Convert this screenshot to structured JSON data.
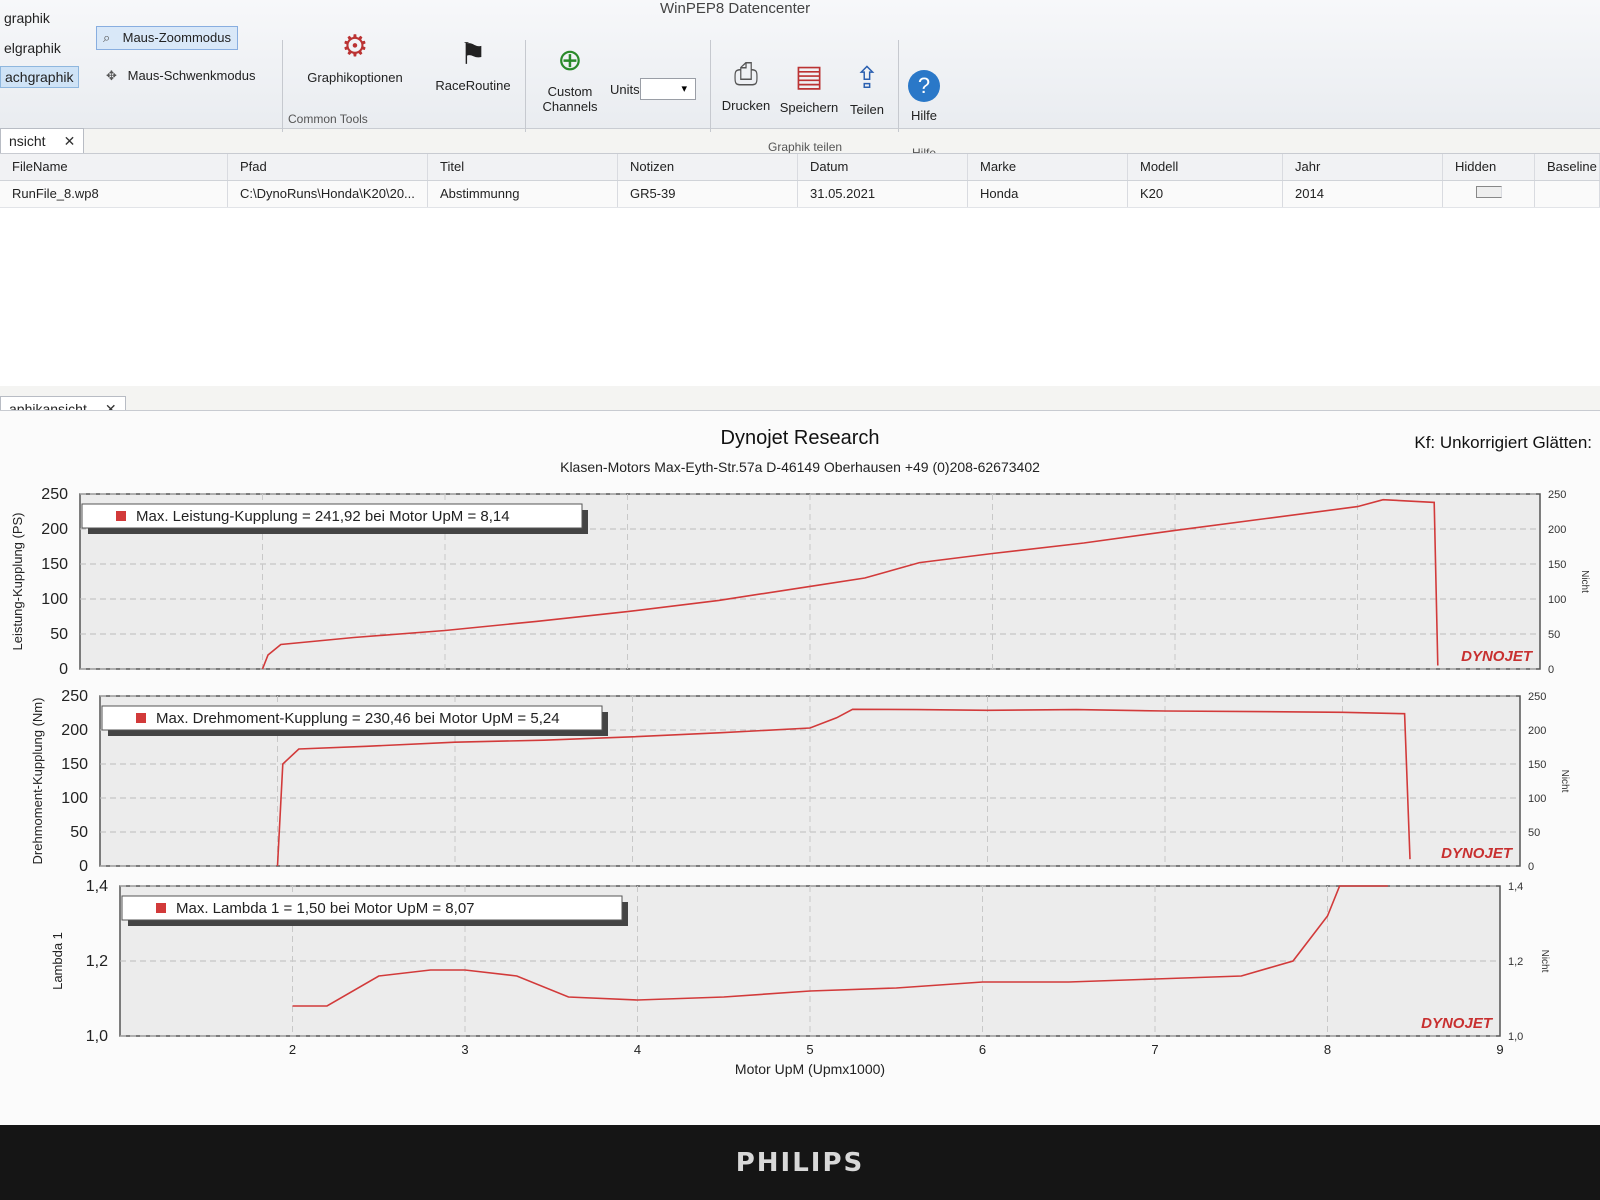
{
  "window": {
    "title": "WinPEP8 Datencenter"
  },
  "ribbon": {
    "left_menu": [
      "graphik",
      "elgraphik",
      "achgraphik"
    ],
    "zoom_mode": "Maus-Zoommodus",
    "pan_mode": "Maus-Schwenkmodus",
    "graph_options": "Graphikoptionen",
    "race_routine": "RaceRoutine",
    "custom_channels": [
      "Custom",
      "Channels"
    ],
    "units_label": "Units",
    "units_value": "",
    "common_tools_group": "Common Tools",
    "print": "Drucken",
    "save": "Speichern",
    "share": "Teilen",
    "share_group": "Graphik teilen",
    "help": "Hilfe",
    "help_group": "Hilfe"
  },
  "file_tab": {
    "label": "nsicht"
  },
  "grid": {
    "columns": [
      "FileName",
      "Pfad",
      "Titel",
      "Notizen",
      "Datum",
      "Marke",
      "Modell",
      "Jahr",
      "Hidden",
      "Baseline"
    ],
    "rows": [
      {
        "filename": "RunFile_8.wp8",
        "pfad": "C:\\DynoRuns\\Honda\\K20\\20...",
        "titel": "Abstimmunng",
        "notizen": "GR5-39",
        "datum": "31.05.2021",
        "marke": "Honda",
        "modell": "K20",
        "jahr": "2014",
        "hidden": false,
        "baseline": ""
      }
    ]
  },
  "graph_tab": {
    "label": "aphikansicht"
  },
  "chart_header": {
    "title": "Dynojet Research",
    "subtitle": "Klasen-Motors   Max-Eyth-Str.57a   D-46149 Oberhausen   +49 (0)208-62673402",
    "kf": "Kf: Unkorrigiert Glätten:"
  },
  "chart_data": [
    {
      "type": "line",
      "ylabel": "Leistung-Kupplung (PS)",
      "y2label": "Nicht",
      "ylim": [
        0,
        250
      ],
      "yticks": [
        "0",
        "50",
        "100",
        "150",
        "200",
        "250"
      ],
      "y2ticks": [
        "0",
        "50",
        "100",
        "150",
        "200",
        "250"
      ],
      "xlim": [
        1.0,
        9.0
      ],
      "legend": "Max. Leistung-Kupplung = 241,92 bei Motor UpM = 8,14",
      "watermark": "DYNOJET",
      "color": "#d23a3a",
      "points": [
        [
          2.0,
          0
        ],
        [
          2.03,
          20
        ],
        [
          2.1,
          35
        ],
        [
          2.5,
          45
        ],
        [
          3.0,
          55
        ],
        [
          3.5,
          68
        ],
        [
          4.0,
          82
        ],
        [
          4.5,
          98
        ],
        [
          5.0,
          118
        ],
        [
          5.3,
          130
        ],
        [
          5.6,
          152
        ],
        [
          6.0,
          165
        ],
        [
          6.5,
          180
        ],
        [
          7.0,
          198
        ],
        [
          7.5,
          215
        ],
        [
          8.0,
          232
        ],
        [
          8.14,
          241.9
        ],
        [
          8.42,
          238
        ],
        [
          8.44,
          5
        ]
      ]
    },
    {
      "type": "line",
      "ylabel": "Drehmoment-Kupplung (Nm)",
      "y2label": "Nicht",
      "ylim": [
        0,
        250
      ],
      "yticks": [
        "0",
        "50",
        "100",
        "150",
        "200",
        "250"
      ],
      "y2ticks": [
        "0",
        "50",
        "100",
        "150",
        "200",
        "250"
      ],
      "xlim": [
        1.0,
        9.0
      ],
      "legend": "Max. Drehmoment-Kupplung = 230,46 bei Motor UpM = 5,24",
      "watermark": "DYNOJET",
      "color": "#d23a3a",
      "points": [
        [
          2.0,
          0
        ],
        [
          2.03,
          150
        ],
        [
          2.12,
          172
        ],
        [
          2.5,
          176
        ],
        [
          3.0,
          182
        ],
        [
          3.5,
          185
        ],
        [
          4.0,
          190
        ],
        [
          4.5,
          196
        ],
        [
          5.0,
          203
        ],
        [
          5.15,
          218
        ],
        [
          5.24,
          230.5
        ],
        [
          5.6,
          230
        ],
        [
          6.0,
          229
        ],
        [
          6.5,
          230
        ],
        [
          7.0,
          228
        ],
        [
          7.5,
          227
        ],
        [
          8.0,
          226
        ],
        [
          8.35,
          224
        ],
        [
          8.38,
          10
        ]
      ]
    },
    {
      "type": "line",
      "ylabel": "Lambda 1",
      "y2label": "Nicht",
      "ylim": [
        1.0,
        1.5
      ],
      "yticks": [
        "1,0",
        "1,2",
        "1,4"
      ],
      "y2ticks": [
        "1,0",
        "1,2",
        "1,4"
      ],
      "xlim": [
        1.0,
        9.0
      ],
      "xlabel": "Motor UpM (Upmx1000)",
      "xticks": [
        "2",
        "3",
        "4",
        "5",
        "6",
        "7",
        "8",
        "9"
      ],
      "legend": "Max. Lambda 1 = 1,50 bei Motor UpM = 8,07",
      "watermark": "DYNOJET",
      "color": "#d23a3a",
      "points": [
        [
          2.0,
          1.1
        ],
        [
          2.2,
          1.1
        ],
        [
          2.5,
          1.2
        ],
        [
          2.8,
          1.22
        ],
        [
          3.0,
          1.22
        ],
        [
          3.3,
          1.2
        ],
        [
          3.6,
          1.13
        ],
        [
          4.0,
          1.12
        ],
        [
          4.5,
          1.13
        ],
        [
          5.0,
          1.15
        ],
        [
          5.5,
          1.16
        ],
        [
          6.0,
          1.18
        ],
        [
          6.5,
          1.18
        ],
        [
          7.0,
          1.19
        ],
        [
          7.5,
          1.2
        ],
        [
          7.8,
          1.25
        ],
        [
          8.0,
          1.4
        ],
        [
          8.07,
          1.5
        ],
        [
          8.35,
          1.5
        ]
      ]
    }
  ]
}
